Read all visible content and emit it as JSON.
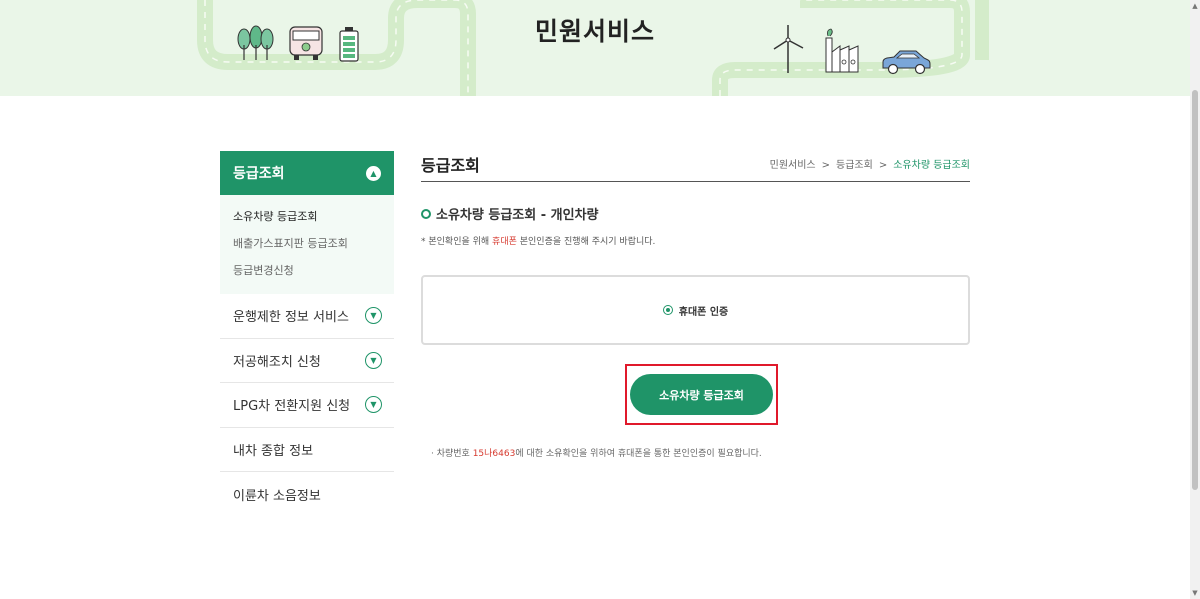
{
  "hero": {
    "title": "민원서비스"
  },
  "sidebar": {
    "active_group": "등급조회",
    "submenu": [
      "소유차량 등급조회",
      "배출가스표지판 등급조회",
      "등급변경신청"
    ],
    "items": [
      {
        "label": "운행제한 정보 서비스"
      },
      {
        "label": "저공해조치 신청"
      },
      {
        "label": "LPG차 전환지원 신청"
      },
      {
        "label": "내차 종합 정보"
      },
      {
        "label": "이륜차 소음정보"
      }
    ]
  },
  "main": {
    "title": "등급조회",
    "breadcrumb": [
      "민원서비스",
      "등급조회",
      "소유차량 등급조회"
    ],
    "breadcrumb_sep": ">",
    "section_title": "소유차량 등급조회 - 개인차량",
    "notice_prefix": "* 본인확인을 위해 ",
    "notice_highlight": "휴대폰",
    "notice_suffix": " 본인인증을 진행해 주시기 바랍니다.",
    "auth_option": "휴대폰 인증",
    "lookup_button": "소유차량 등급조회",
    "footnote_prefix": "· 차량번호 ",
    "footnote_plate": "15나6463",
    "footnote_suffix": "에 대한 소유확인을 위하여 휴대폰을 통한 본인인증이 필요합니다."
  },
  "colors": {
    "accent": "#1f9468",
    "highlight_red": "#e0192b",
    "hero_bg": "#eaf6e8"
  },
  "icons": [
    "trees-icon",
    "bus-icon",
    "battery-icon",
    "wind-turbine-icon",
    "factory-icon",
    "electric-car-icon"
  ]
}
